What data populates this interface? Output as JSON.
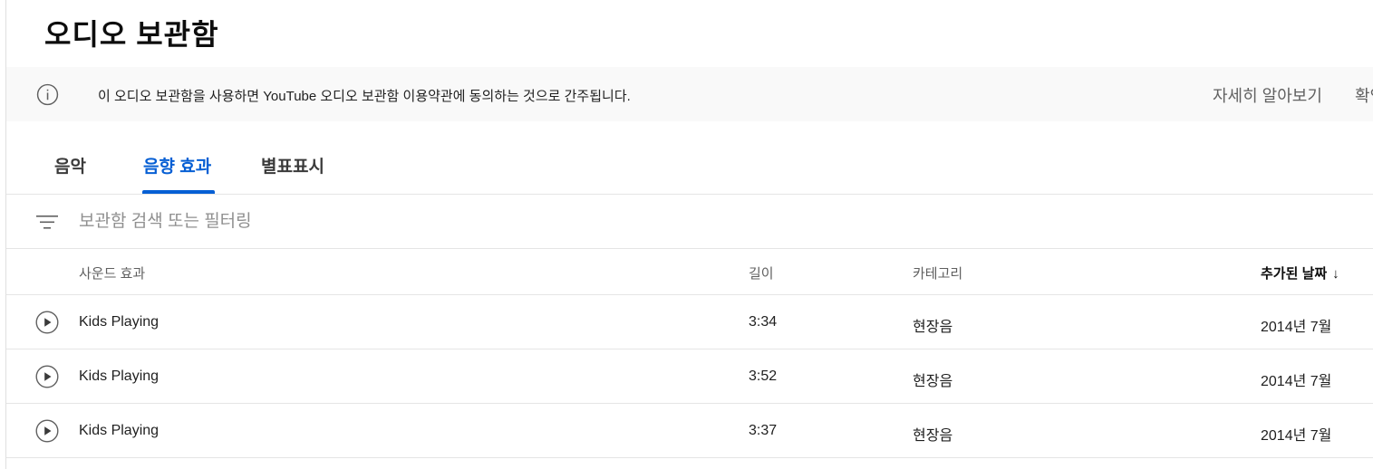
{
  "page": {
    "title": "오디오 보관함"
  },
  "notice": {
    "icon": "info-icon",
    "text": "이 오디오 보관함을 사용하면 YouTube 오디오 보관함 이용약관에 동의하는 것으로 간주됩니다.",
    "learn_more": "자세히 알아보기",
    "confirm": "확인"
  },
  "tabs": [
    {
      "label": "음악",
      "active": false
    },
    {
      "label": "음향 효과",
      "active": true
    },
    {
      "label": "별표표시",
      "active": false
    }
  ],
  "filter": {
    "icon": "filter-icon",
    "placeholder": "보관함 검색 또는 필터링",
    "value": ""
  },
  "table": {
    "columns": {
      "name": "사운드 효과",
      "length": "길이",
      "category": "카테고리",
      "date_added": "추가된 날짜",
      "sort_indicator": "↓"
    },
    "rows": [
      {
        "name": "Kids Playing",
        "length": "3:34",
        "category": "현장음",
        "date_added": "2014년 7월"
      },
      {
        "name": "Kids Playing",
        "length": "3:52",
        "category": "현장음",
        "date_added": "2014년 7월"
      },
      {
        "name": "Kids Playing",
        "length": "3:37",
        "category": "현장음",
        "date_added": "2014년 7월"
      }
    ]
  },
  "colors": {
    "accent": "#065fd4",
    "notice_bg": "#f9f9f9",
    "divider": "#e5e5e5"
  }
}
